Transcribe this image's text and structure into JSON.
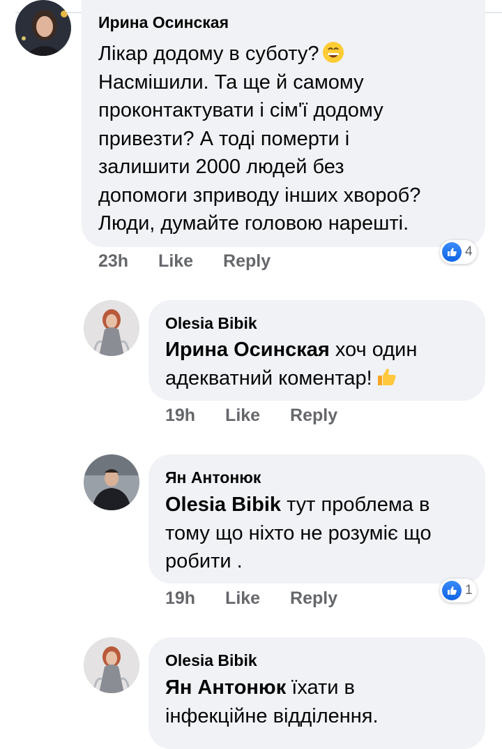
{
  "comments": [
    {
      "author": "Ирина Осинская",
      "lines": [
        "Лікар додому в суботу?",
        "Насмішили. Та ще й самому",
        "проконтактувати і сім'ї додому",
        "привезти? А тоді померти і",
        "залишити 2000 людей без",
        "допомоги зприводу інших хвороб?",
        "Люди, думайте головою нарешті."
      ],
      "emoji": "grinning-face-emoji",
      "time": "23h",
      "like": "Like",
      "reply": "Reply",
      "reactions": "4"
    },
    {
      "author": "Olesia Bibik",
      "mention": "Ирина Осинская",
      "line1_rest": " хоч один",
      "line2": "адекватний  коментар!",
      "emoji": "thumbs-up-emoji",
      "time": "19h",
      "like": "Like",
      "reply": "Reply"
    },
    {
      "author": "Ян Антонюк",
      "mention": "Olesia Bibik",
      "line1_rest": " тут проблема в",
      "line2": "тому що ніхто не розуміє що",
      "line3": "робити .",
      "time": "19h",
      "like": "Like",
      "reply": "Reply",
      "reactions": "1"
    },
    {
      "author": "Olesia Bibik",
      "mention": "Ян Антонюк",
      "line1_rest": " їхати в",
      "line2": "інфекційне відділення."
    }
  ],
  "colors": {
    "bubble": "#f0f2f5",
    "meta": "#65676b",
    "like_blue": "#1877f2"
  }
}
